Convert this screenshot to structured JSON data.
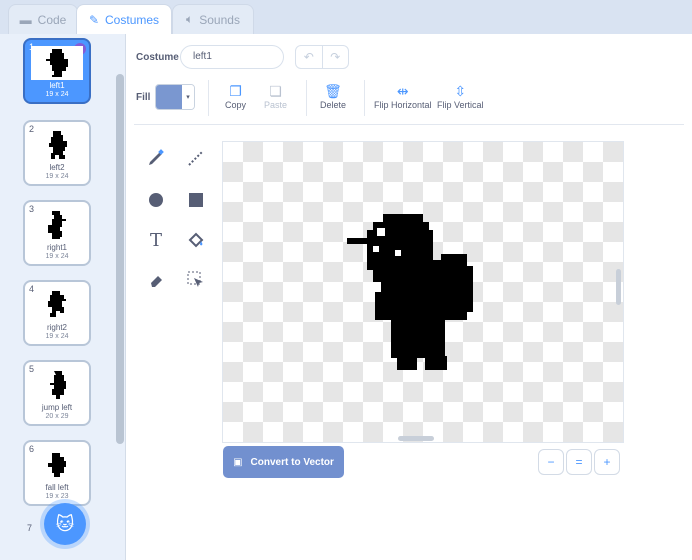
{
  "tabs": [
    {
      "label": "Code",
      "icon": "code-icon",
      "active": false
    },
    {
      "label": "Costumes",
      "icon": "brush-icon",
      "active": true
    },
    {
      "label": "Sounds",
      "icon": "speaker-icon",
      "active": false
    }
  ],
  "costumes": [
    {
      "number": "1",
      "name": "left1",
      "size": "19 x 24",
      "selected": true
    },
    {
      "number": "2",
      "name": "left2",
      "size": "19 x 24",
      "selected": false
    },
    {
      "number": "3",
      "name": "right1",
      "size": "19 x 24",
      "selected": false
    },
    {
      "number": "4",
      "name": "right2",
      "size": "19 x 24",
      "selected": false
    },
    {
      "number": "5",
      "name": "jump left",
      "size": "20 x 29",
      "selected": false
    },
    {
      "number": "6",
      "name": "fall left",
      "size": "19 x 23",
      "selected": false
    },
    {
      "number": "7"
    }
  ],
  "editor": {
    "costume_label": "Costume",
    "costume_name": "left1",
    "fill_label": "Fill",
    "fill_color": "#7a97d0",
    "copy_label": "Copy",
    "paste_label": "Paste",
    "delete_label": "Delete",
    "flip_h_label": "Flip Horizontal",
    "flip_v_label": "Flip Vertical",
    "convert_label": "Convert to Vector",
    "zoom_out": "−",
    "zoom_reset": "=",
    "zoom_in": "+"
  },
  "colors": {
    "accent": "#4c97ff",
    "selected_border": "#3a6fc4",
    "convert_button": "#7290cf"
  }
}
